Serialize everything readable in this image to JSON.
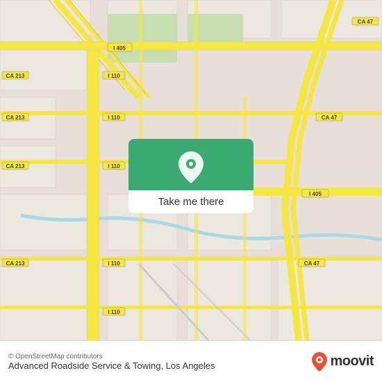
{
  "map": {
    "attribution": "© OpenStreetMap contributors",
    "background_color": "#e8e0d8"
  },
  "button": {
    "label": "Take me there",
    "bg_color": "#3aaa72"
  },
  "bottom_bar": {
    "business_name": "Advanced Roadside Service & Towing, Los Angeles",
    "logo_text": "moovit"
  },
  "road_labels": [
    {
      "id": "i405-top",
      "text": "I 405"
    },
    {
      "id": "ca213-1",
      "text": "CA 213"
    },
    {
      "id": "ca213-2",
      "text": "CA 213"
    },
    {
      "id": "ca213-3",
      "text": "CA 213"
    },
    {
      "id": "ca213-4",
      "text": "CA 213"
    },
    {
      "id": "i110-1",
      "text": "I 110"
    },
    {
      "id": "i110-2",
      "text": "I 110"
    },
    {
      "id": "i110-3",
      "text": "I 110"
    },
    {
      "id": "i110-4",
      "text": "I 110"
    },
    {
      "id": "i405-mid",
      "text": "I 405"
    },
    {
      "id": "ca47-1",
      "text": "CA 47"
    },
    {
      "id": "ca47-2",
      "text": "CA 47"
    },
    {
      "id": "ca47-3",
      "text": "CA 47"
    }
  ],
  "icons": {
    "map_pin": "📍",
    "moovit_pin_color": "#e8503a"
  }
}
